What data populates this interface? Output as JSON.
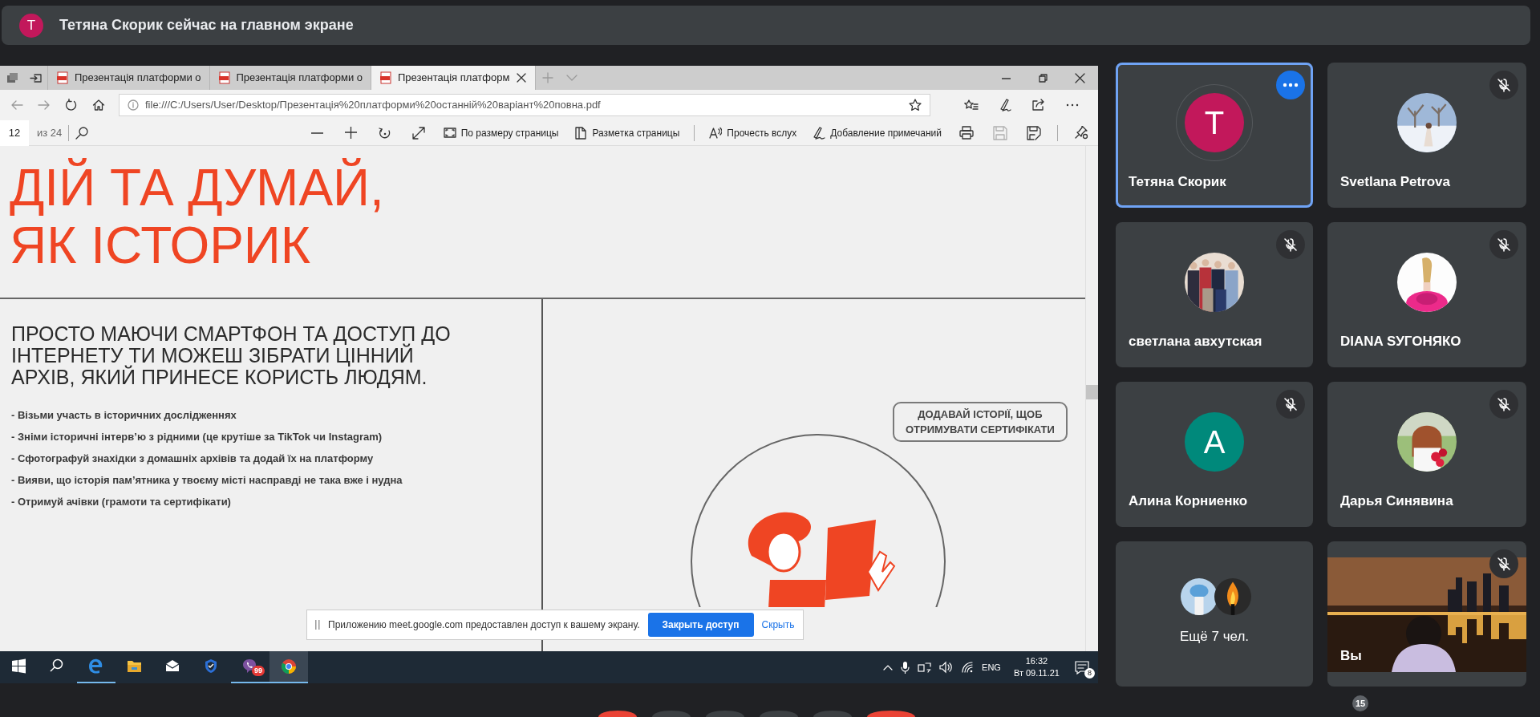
{
  "banner": {
    "avatar": "T",
    "text": "Тетяна Скорик сейчас на главном экране"
  },
  "shared_screen": {
    "browser": {
      "tabs": [
        {
          "title": "Презентація платформи о",
          "selected": false
        },
        {
          "title": "Презентація платформи о",
          "selected": false
        },
        {
          "title": "Презентація платформ",
          "selected": true
        }
      ],
      "url": "file:///C:/Users/User/Desktop/Презентація%20платформи%20останній%20варіант%20повна.pdf"
    },
    "pdf_toolbar": {
      "page": "12",
      "page_count": "из 24",
      "tools": [
        {
          "kind": "fit",
          "label": "По размеру страницы"
        },
        {
          "kind": "layout",
          "label": "Разметка страницы"
        },
        {
          "kind": "read",
          "label": "Прочесть вслух"
        },
        {
          "kind": "notes",
          "label": "Добавление примечаний"
        }
      ],
      "actions": [
        {
          "kind": "print",
          "disabled": false
        },
        {
          "kind": "save",
          "disabled": true
        },
        {
          "kind": "save-as",
          "disabled": false
        }
      ]
    },
    "slide": {
      "title": "ДІЙ ТА ДУМАЙ,\nЯК ІСТОРИК",
      "heading": "ПРОСТО МАЮЧИ СМАРТФОН ТА ДОСТУП ДО\nІНТЕРНЕТУ ТИ МОЖЕШ ЗІБРАТИ ЦІННИЙ\nАРХІВ, ЯКИЙ ПРИНЕСЕ КОРИСТЬ ЛЮДЯМ.",
      "bullets": [
        "- Візьми участь в історичних дослідженнях",
        "- Зніми історичні інтерв’ю з рідними (це крутіше за TikTok чи Instagram)",
        "- Сфотографуй знахідки з домашніх архівів та додай їх на платформу",
        "- Вияви, що історія пам’ятника у твоєму місті насправді не така вже і нудна",
        "- Отримуй ачівки (грамоти та сертифікати)"
      ],
      "bubble": "ДОДАВАЙ ІСТОРІЇ, ЩОБ\nОТРИМУВАТИ СЕРТИФІКАТИ"
    },
    "share_notice": {
      "text": "Приложению meet.google.com предоставлен доступ к вашему экрану.",
      "stop_button": "Закрыть доступ",
      "hide_link": "Скрыть"
    },
    "taskbar": {
      "apps": [
        {
          "kind": "start",
          "running": false,
          "selected": false
        },
        {
          "kind": "search",
          "running": false,
          "selected": false
        },
        {
          "kind": "edge",
          "running": true,
          "selected": false
        },
        {
          "kind": "folder",
          "running": false,
          "selected": false
        },
        {
          "kind": "mail",
          "running": false,
          "selected": false
        },
        {
          "kind": "shield",
          "running": false,
          "selected": false
        },
        {
          "kind": "viber",
          "running": true,
          "selected": false,
          "badge": "99"
        },
        {
          "kind": "chrome",
          "running": true,
          "selected": true
        }
      ],
      "language": "ENG",
      "time": "16:32",
      "date": "Вт 09.11.21",
      "notifications": "8"
    }
  },
  "participants": [
    {
      "name": "Тетяна Скорик",
      "kind": "letter",
      "letter": "T",
      "color": "#c2185b",
      "muted": false,
      "selected": true
    },
    {
      "name": "Svetlana Petrova",
      "kind": "picture",
      "muted": true,
      "selected": false
    },
    {
      "name": "светлана авхутская",
      "kind": "picture",
      "muted": true,
      "selected": false
    },
    {
      "name": "DIANA SУГОНЯКО",
      "kind": "picture",
      "muted": true,
      "selected": false
    },
    {
      "name": "Алина Корниенко",
      "kind": "letter",
      "letter": "A",
      "color": "#00897b",
      "muted": true,
      "selected": false
    },
    {
      "name": "Дарья Синявина",
      "kind": "picture",
      "muted": true,
      "selected": false
    },
    {
      "name": "Ещё 7 чел.",
      "kind": "stack",
      "muted": false,
      "selected": false
    },
    {
      "name": "Вы",
      "kind": "video",
      "muted": true,
      "selected": false
    }
  ],
  "participant_count": "15",
  "call_controls": [
    {
      "kind": "round",
      "color": "#ea4335"
    },
    {
      "kind": "round",
      "color": "#3c4043"
    },
    {
      "kind": "round",
      "color": "#3c4043"
    },
    {
      "kind": "round",
      "color": "#3c4043"
    },
    {
      "kind": "round",
      "color": "#3c4043"
    },
    {
      "kind": "pill",
      "color": "#ea4335"
    }
  ]
}
